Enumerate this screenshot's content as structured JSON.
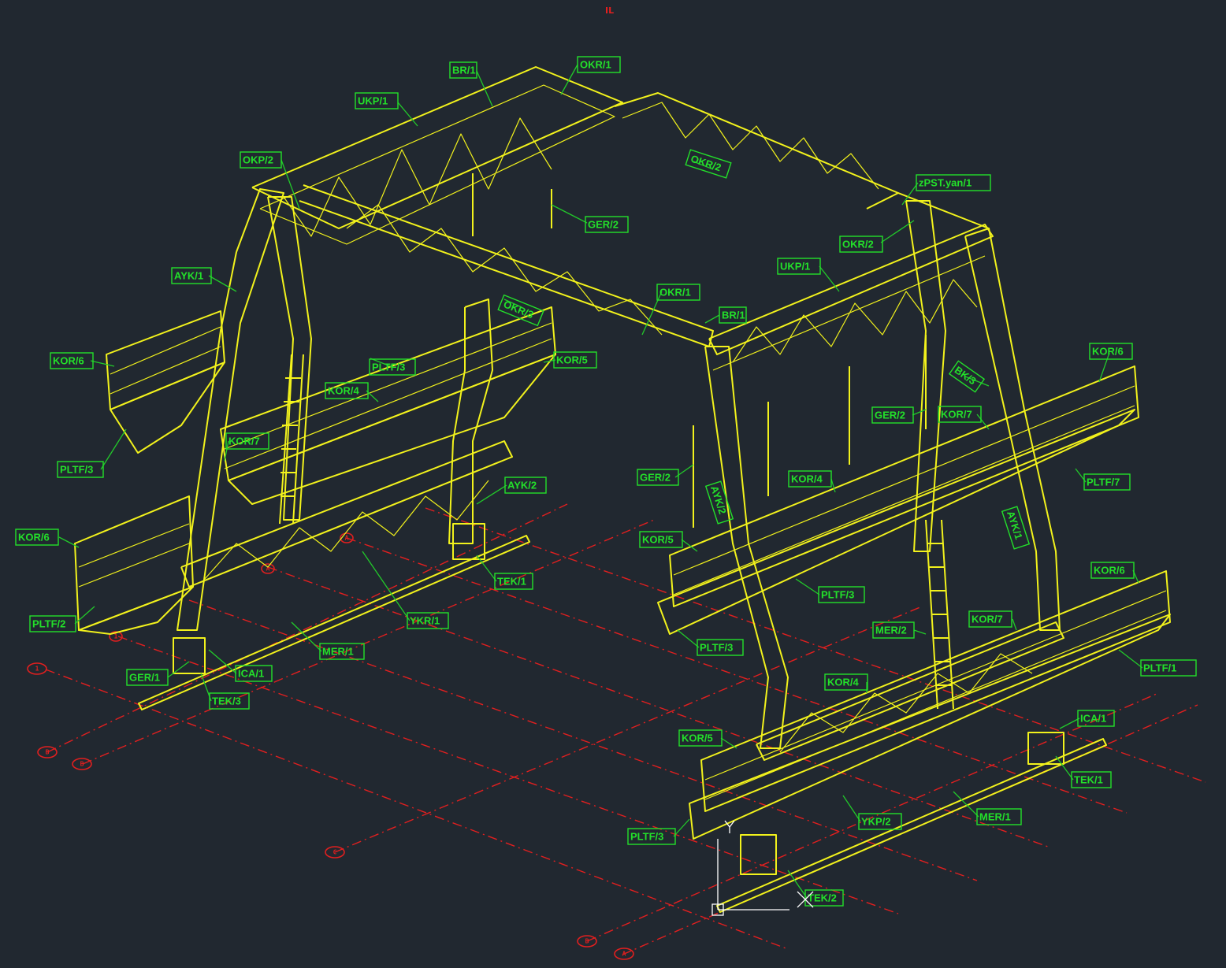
{
  "drawing": {
    "top_mark": "IL",
    "colors": {
      "background": "#212830",
      "structure": "#f2f21c",
      "tags": "#23e02a",
      "grid_lines": "#e21f1f",
      "ucs_icon": "#ffffff"
    },
    "grid_bubbles": [
      "1",
      "B",
      "B",
      "C",
      "B",
      "A",
      "A",
      "A",
      "1"
    ],
    "part_tags": [
      "BR/1",
      "OKR/1",
      "UKP/1",
      "OKP/2",
      "OKR/2",
      "zPST.yan/1",
      "GER/2",
      "OKR/2",
      "AYK/1",
      "UKP/1",
      "OKR/1",
      "BR/1",
      "OKR/3",
      "KOR/6",
      "PLTF/3",
      "KOR/5",
      "KOR/6",
      "BK/3",
      "KOR/4",
      "GER/2",
      "KOR/7",
      "KOR/7",
      "PLTF/3",
      "GER/2",
      "AYK/2",
      "KOR/4",
      "PLTF/7",
      "AYK/2",
      "AYK/1",
      "KOR/6",
      "KOR/5",
      "TEK/1",
      "PLTF/2",
      "YKR/1",
      "PLTF/3",
      "KOR/6",
      "MER/2",
      "PLTF/3",
      "KOR/7",
      "ICA/1",
      "GER/1",
      "MER/1",
      "PLTF/1",
      "TEK/3",
      "KOR/4",
      "ICA/1",
      "KOR/5",
      "TEK/1",
      "YKP/2",
      "MER/1",
      "PLTF/3",
      "TEK/2"
    ]
  }
}
